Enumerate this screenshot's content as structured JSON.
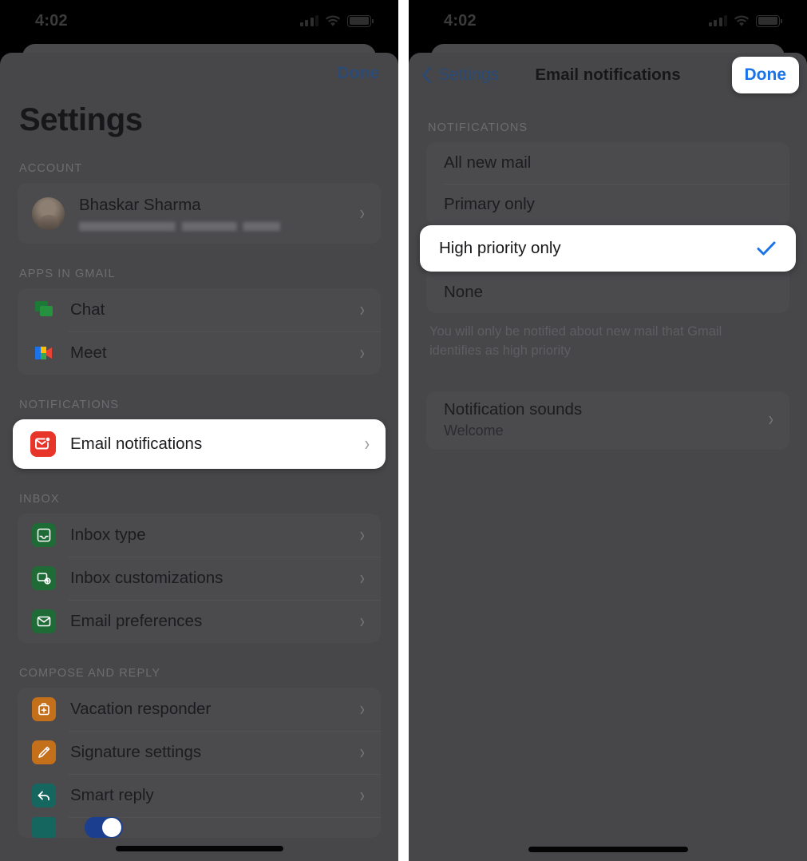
{
  "status_bar": {
    "time": "4:02",
    "icons": [
      "cellular-signal-icon",
      "wifi-icon",
      "battery-icon"
    ]
  },
  "left_panel": {
    "done_label": "Done",
    "title": "Settings",
    "sections": [
      {
        "label": "ACCOUNT",
        "rows": [
          {
            "name": "Bhaskar Sharma",
            "email_redacted": true,
            "chevron": "›"
          }
        ]
      },
      {
        "label": "APPS IN GMAIL",
        "rows": [
          {
            "label": "Chat",
            "icon": "google-chat-icon",
            "chevron": "›"
          },
          {
            "label": "Meet",
            "icon": "google-meet-icon",
            "chevron": "›"
          }
        ]
      },
      {
        "label": "NOTIFICATIONS",
        "rows": [
          {
            "label": "Email notifications",
            "icon": "email-notifications-icon",
            "chevron": "›",
            "highlighted": true
          }
        ]
      },
      {
        "label": "INBOX",
        "rows": [
          {
            "label": "Inbox type",
            "icon": "inbox-type-icon",
            "chevron": "›"
          },
          {
            "label": "Inbox customizations",
            "icon": "inbox-customizations-icon",
            "chevron": "›"
          },
          {
            "label": "Email preferences",
            "icon": "email-preferences-icon",
            "chevron": "›"
          }
        ]
      },
      {
        "label": "COMPOSE AND REPLY",
        "rows": [
          {
            "label": "Vacation responder",
            "icon": "vacation-responder-icon",
            "chevron": "›"
          },
          {
            "label": "Signature settings",
            "icon": "signature-settings-icon",
            "chevron": "›"
          },
          {
            "label": "Smart reply",
            "icon": "smart-reply-icon",
            "chevron": "›"
          }
        ]
      }
    ]
  },
  "right_panel": {
    "back_label": "Settings",
    "title": "Email notifications",
    "done_label": "Done",
    "section_label": "NOTIFICATIONS",
    "options": [
      {
        "label": "All new mail",
        "selected": false
      },
      {
        "label": "Primary only",
        "selected": false
      },
      {
        "label": "High priority only",
        "selected": true
      },
      {
        "label": "None",
        "selected": false
      }
    ],
    "helper_text": "You will only be notified about new mail that Gmail identifies as high priority",
    "sounds": {
      "title": "Notification sounds",
      "value": "Welcome",
      "chevron": "›"
    }
  },
  "colors": {
    "accent_blue": "#1a73e8",
    "link_blue": "#2c4a73",
    "gmail_red": "#e8352a",
    "sheet_bg": "#474749",
    "card_bg": "#4b4b4e",
    "highlight_white": "#ffffff",
    "icon_green": "#1e6b35",
    "icon_orange": "#c4701a",
    "icon_teal": "#14665f"
  }
}
